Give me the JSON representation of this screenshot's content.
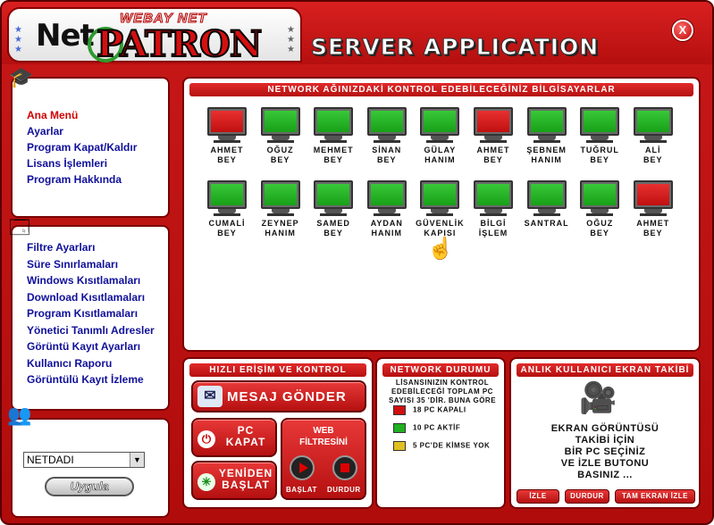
{
  "header": {
    "logo_net": "Net",
    "logo_webay": "WEBAY NET",
    "logo_patron": "PATRON",
    "title": "SERVER APPLICATION",
    "close_label": "X"
  },
  "sidebar": {
    "main_menu": [
      {
        "label": "Ana Menü",
        "active": true
      },
      {
        "label": "Ayarlar"
      },
      {
        "label": "Program Kapat/Kaldır"
      },
      {
        "label": "Lisans İşlemleri"
      },
      {
        "label": "Program Hakkında"
      }
    ],
    "restrictions_menu": [
      {
        "label": "Filtre Ayarları"
      },
      {
        "label": "Süre Sınırlamaları"
      },
      {
        "label": "Windows Kısıtlamaları"
      },
      {
        "label": "Download Kısıtlamaları"
      },
      {
        "label": "Program Kısıtlamaları"
      },
      {
        "label": "Yönetici Tanımlı Adresler"
      },
      {
        "label": "Görüntü Kayıt Ayarları"
      },
      {
        "label": "Kullanıcı Raporu"
      },
      {
        "label": "Görüntülü Kayıt İzleme"
      }
    ],
    "select_value": "NETDADI",
    "apply_label": "Uygula"
  },
  "network": {
    "header": "NETWORK AĞINIZDAKİ KONTROL EDEBİLECEĞİNİZ BİLGİSAYARLAR",
    "computers": [
      {
        "name": "AHMET\nBEY",
        "status": "red"
      },
      {
        "name": "OĞUZ\nBEY",
        "status": "green"
      },
      {
        "name": "MEHMET\nBEY",
        "status": "green"
      },
      {
        "name": "SİNAN\nBEY",
        "status": "green"
      },
      {
        "name": "GÜLAY\nHANIM",
        "status": "green"
      },
      {
        "name": "AHMET\nBEY",
        "status": "red"
      },
      {
        "name": "ŞEBNEM\nHANIM",
        "status": "green"
      },
      {
        "name": "TUĞRUL\nBEY",
        "status": "green"
      },
      {
        "name": "ALİ\nBEY",
        "status": "green"
      },
      {
        "name": "CUMALİ\nBEY",
        "status": "green"
      },
      {
        "name": "ZEYNEP\nHANIM",
        "status": "green"
      },
      {
        "name": "SAMED\nBEY",
        "status": "green"
      },
      {
        "name": "AYDAN\nHANIM",
        "status": "green"
      },
      {
        "name": "GÜVENLİK\nKAPISI",
        "status": "green"
      },
      {
        "name": "BİLGİ\nİŞLEM",
        "status": "green"
      },
      {
        "name": "SANTRAL",
        "status": "green"
      },
      {
        "name": "OĞUZ\nBEY",
        "status": "green"
      },
      {
        "name": "AHMET\nBEY",
        "status": "red"
      }
    ]
  },
  "quick_access": {
    "header": "HIZLI ERİŞİM VE KONTROL",
    "send_message": "MESAJ GÖNDER",
    "pc_off": "PC\nKAPAT",
    "restart": "YENİDEN\nBAŞLAT",
    "web_filter": "WEB\nFİLTRESİNİ",
    "web_start": "BAŞLAT",
    "web_stop": "DURDUR"
  },
  "network_status": {
    "header": "NETWORK DURUMU",
    "summary": "LİSANSINIZIN KONTROL EDEBİLECEĞİ TOPLAM PC SAYISI 35 'DİR. BUNA GÖRE",
    "rows": [
      {
        "label": "18 PC KAPALI",
        "color": "#d01010"
      },
      {
        "label": "10 PC AKTİF",
        "color": "#20b020"
      },
      {
        "label": "5 PC'DE KİMSE YOK",
        "color": "#e0c020"
      }
    ]
  },
  "screen_tracking": {
    "header": "ANLIK KULLANICI EKRAN TAKİBİ",
    "message": "EKRAN GÖRÜNTÜSÜ\nTAKİBİ İÇİN\nBİR PC SEÇİNİZ\nVE İZLE BUTONU\nBASINIZ ...",
    "watch": "İZLE",
    "stop": "DURDUR",
    "fullscreen": "TAM EKRAN İZLE"
  }
}
